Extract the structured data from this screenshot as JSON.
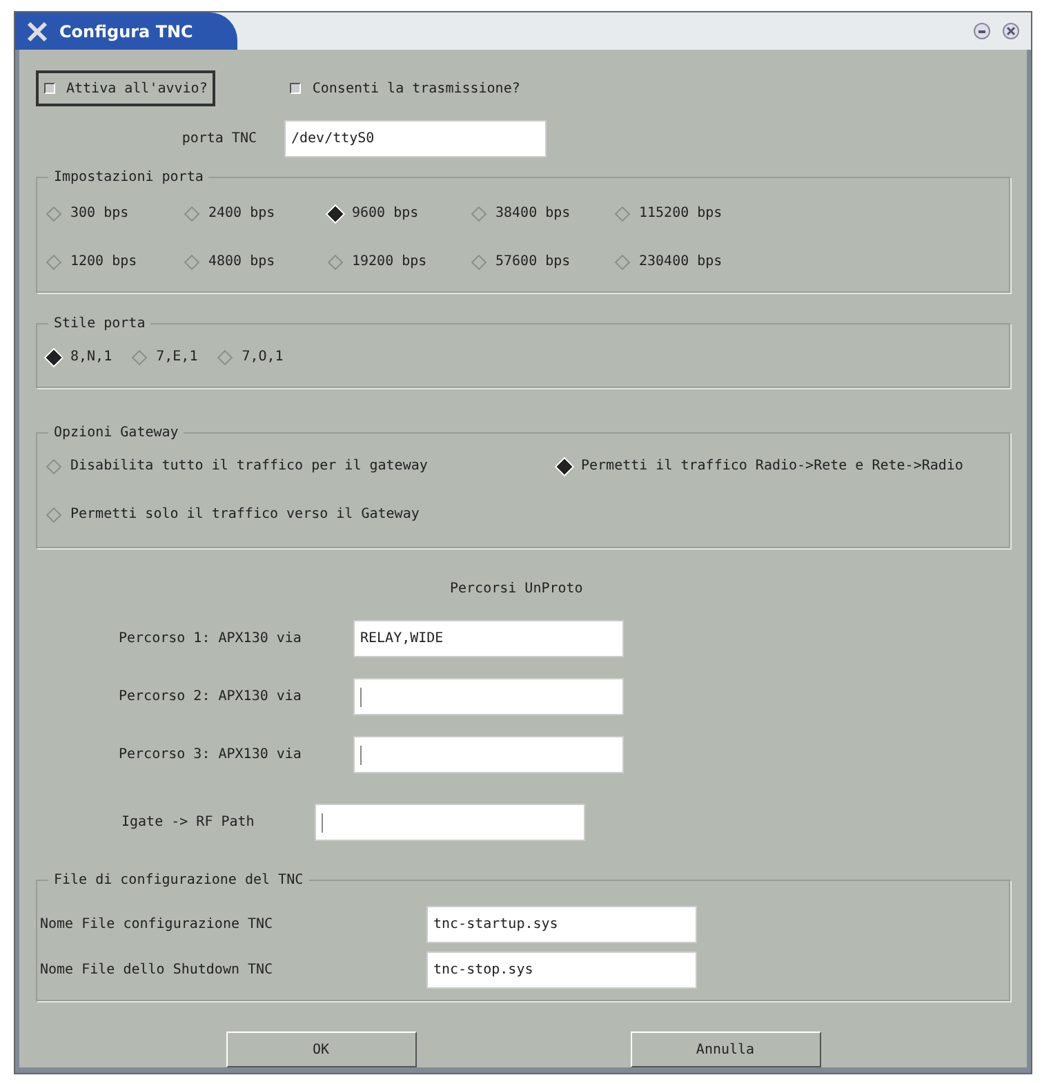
{
  "window": {
    "title": "Configura TNC"
  },
  "options": [
    {
      "label": "Attiva all'avvio?",
      "checked": false,
      "focused": true
    },
    {
      "label": "Consenti la trasmissione?",
      "checked": false,
      "focused": false
    }
  ],
  "port": {
    "label": "porta TNC",
    "value": "/dev/ttyS0"
  },
  "port_settings": {
    "title": "Impostazioni porta",
    "options": [
      {
        "label": "300 bps",
        "selected": false
      },
      {
        "label": "2400 bps",
        "selected": false
      },
      {
        "label": "9600 bps",
        "selected": true
      },
      {
        "label": "38400 bps",
        "selected": false
      },
      {
        "label": "115200 bps",
        "selected": false
      },
      {
        "label": "1200 bps",
        "selected": false
      },
      {
        "label": "4800 bps",
        "selected": false
      },
      {
        "label": "19200 bps",
        "selected": false
      },
      {
        "label": "57600 bps",
        "selected": false
      },
      {
        "label": "230400 bps",
        "selected": false
      }
    ]
  },
  "port_style": {
    "title": "Stile porta",
    "options": [
      {
        "label": "8,N,1",
        "selected": true
      },
      {
        "label": "7,E,1",
        "selected": false
      },
      {
        "label": "7,O,1",
        "selected": false
      }
    ]
  },
  "gateway": {
    "title": "Opzioni Gateway",
    "options": [
      {
        "label": "Disabilita tutto il traffico per il gateway",
        "selected": false
      },
      {
        "label": "Permetti il traffico Radio->Rete e Rete->Radio",
        "selected": true
      },
      {
        "label": "Permetti solo il traffico verso il Gateway",
        "selected": false
      }
    ]
  },
  "unproto": {
    "title": "Percorsi UnProto",
    "paths": [
      {
        "label": "Percorso 1: APX130 via",
        "value": "RELAY,WIDE"
      },
      {
        "label": "Percorso 2: APX130 via"
      },
      {
        "label": "Percorso 3: APX130 via"
      }
    ],
    "igate": {
      "label": "Igate -> RF Path"
    }
  },
  "config_files": {
    "title": "File di configurazione del TNC",
    "rows": [
      {
        "label": "Nome File configurazione TNC",
        "value": "tnc-startup.sys"
      },
      {
        "label": "Nome File dello Shutdown TNC",
        "value": "tnc-stop.sys"
      }
    ]
  },
  "buttons": [
    "OK",
    "Annulla"
  ]
}
